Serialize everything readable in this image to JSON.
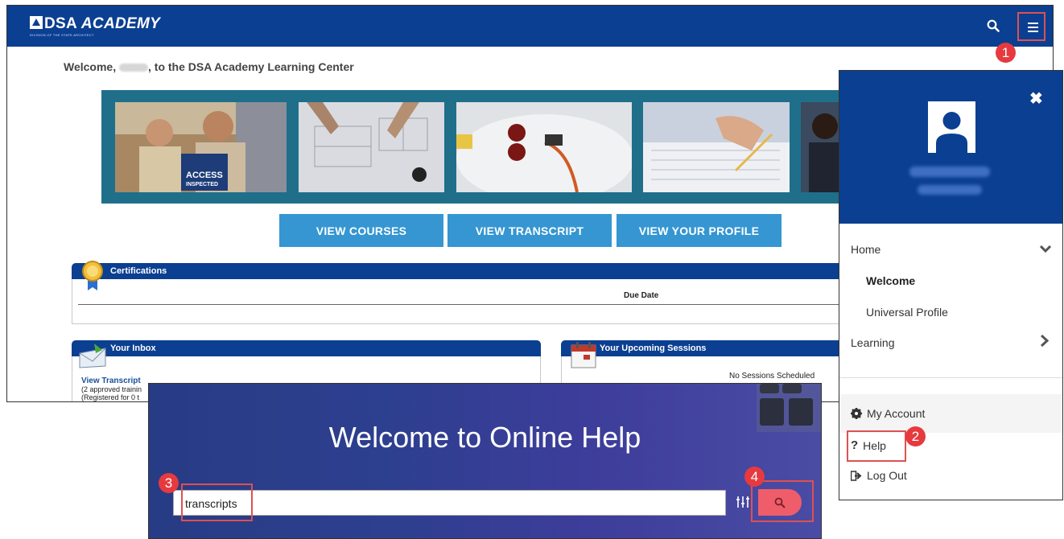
{
  "app": {
    "logo_main": "DSA",
    "logo_academy": "ACADEMY",
    "logo_sub": "DIVISION OF THE STATE ARCHITECT"
  },
  "main": {
    "welcome_prefix": "Welcome,",
    "welcome_suffix": ", to the DSA Academy Learning Center",
    "buttons": {
      "courses": "VIEW COURSES",
      "transcript": "VIEW TRANSCRIPT",
      "profile": "VIEW YOUR PROFILE"
    },
    "banner": {
      "access_line1": "ACCESS",
      "access_line2": "INSPECTED"
    },
    "certifications": {
      "title": "Certifications",
      "col_due_date": "Due Date"
    },
    "inbox": {
      "title": "Your Inbox",
      "link": "View Transcript",
      "line1": "(2 approved trainin",
      "line2": "(Registered for 0 t"
    },
    "sessions": {
      "title": "Your Upcoming Sessions",
      "empty": "No Sessions Scheduled"
    }
  },
  "side_menu": {
    "items": {
      "home": "Home",
      "welcome": "Welcome",
      "universal_profile": "Universal Profile",
      "learning": "Learning"
    },
    "account": "My Account",
    "help": "Help",
    "logout": "Log Out"
  },
  "help_panel": {
    "title": "Welcome to Online Help",
    "query": "transcripts"
  },
  "badges": {
    "b1": "1",
    "b2": "2",
    "b3": "3",
    "b4": "4"
  },
  "colors": {
    "nav_blue": "#0b3f91",
    "cta_blue": "#3596d2",
    "callout_red": "#e63a3f",
    "search_btn": "#ef5d6a"
  }
}
